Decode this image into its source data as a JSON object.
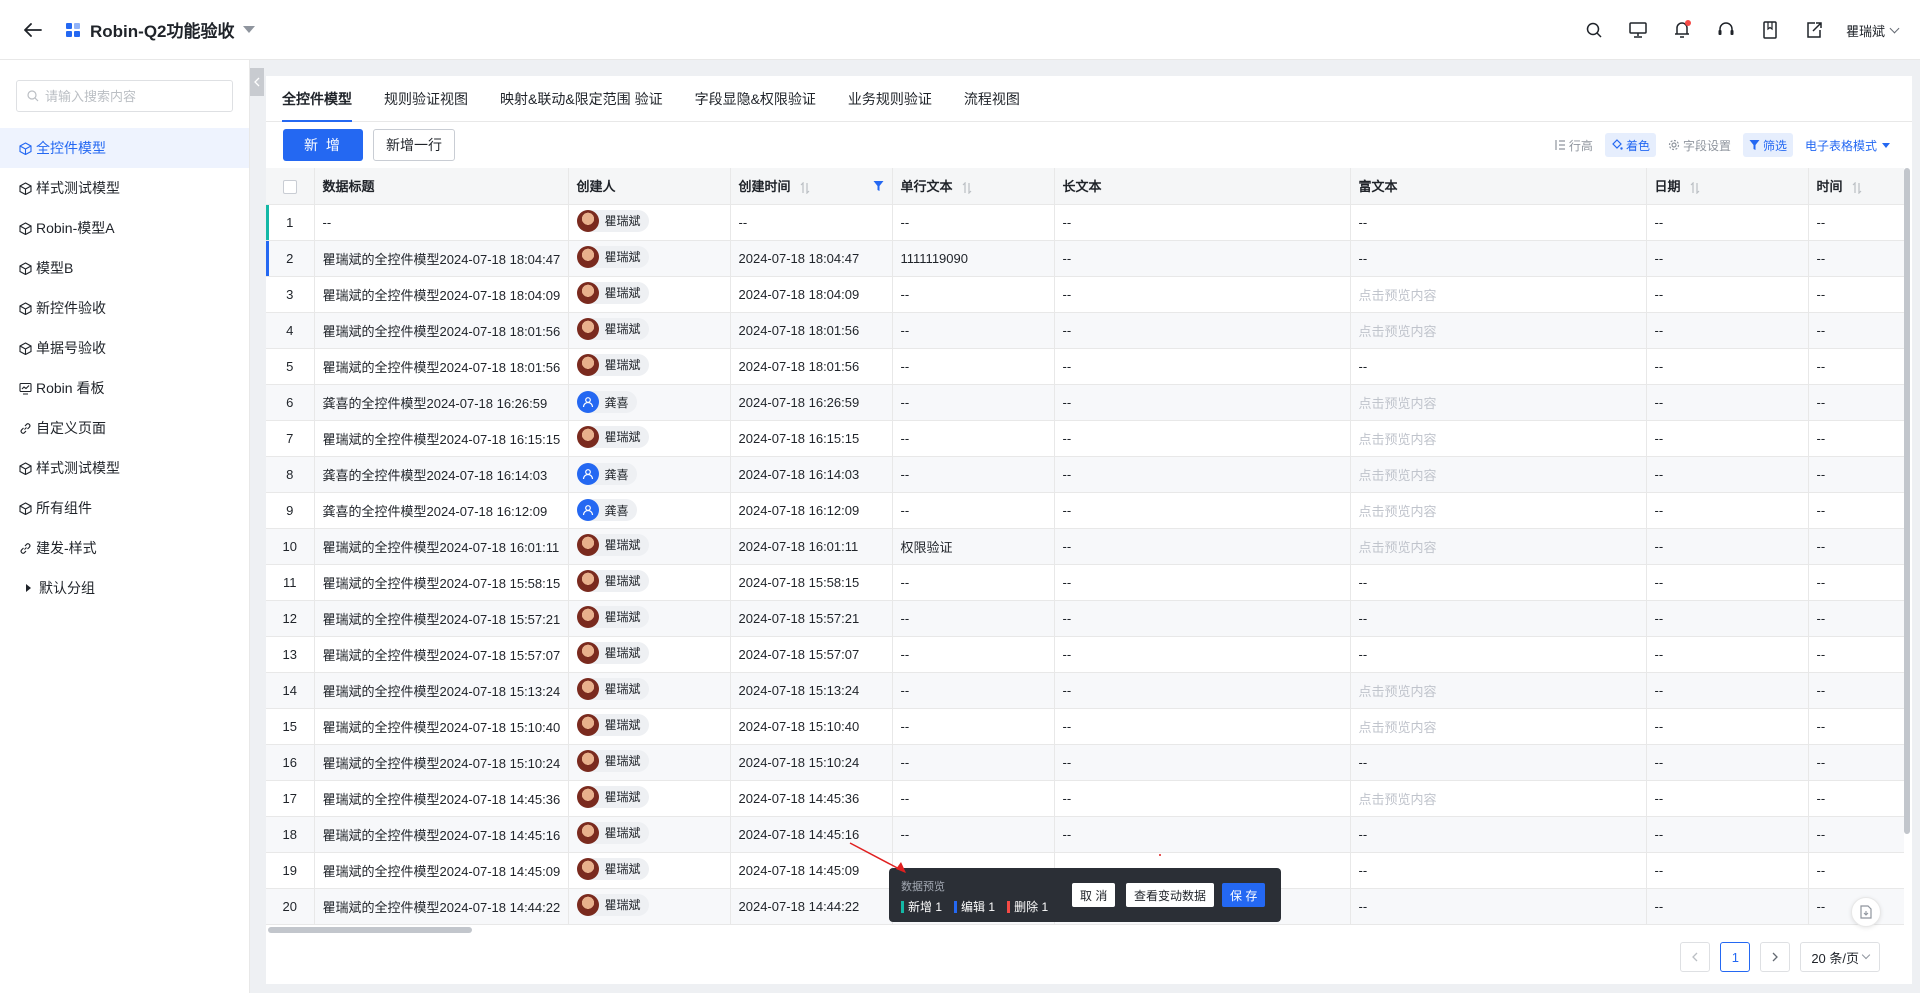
{
  "header": {
    "title": "Robin-Q2功能验收",
    "user_name": "瞿瑞斌"
  },
  "sidebar": {
    "search_placeholder": "请输入搜索内容",
    "items": [
      {
        "label": "全控件模型",
        "icon": "cube-icon",
        "active": true
      },
      {
        "label": "样式测试模型",
        "icon": "cube-icon"
      },
      {
        "label": "Robin-模型A",
        "icon": "cube-icon"
      },
      {
        "label": "模型B",
        "icon": "cube-icon"
      },
      {
        "label": "新控件验收",
        "icon": "cube-icon"
      },
      {
        "label": "单据号验收",
        "icon": "cube-icon"
      },
      {
        "label": "Robin 看板",
        "icon": "dashboard-icon"
      },
      {
        "label": "自定义页面",
        "icon": "link-icon"
      },
      {
        "label": "样式测试模型",
        "icon": "cube-icon"
      },
      {
        "label": "所有组件",
        "icon": "cube-icon"
      },
      {
        "label": "建发-样式",
        "icon": "link-icon"
      },
      {
        "label": "默认分组",
        "icon": "caret-right-icon"
      }
    ]
  },
  "tabs": [
    "全控件模型",
    "规则验证视图",
    "映射&联动&限定范围 验证",
    "字段显隐&权限验证",
    "业务规则验证",
    "流程视图"
  ],
  "toolbar": {
    "add_label": "新 增",
    "add_row_label": "新增一行",
    "row_height_label": "行高",
    "color_label": "着色",
    "field_settings_label": "字段设置",
    "filter_label": "筛选",
    "mode_label": "电子表格模式"
  },
  "table": {
    "columns": [
      "数据标题",
      "创建人",
      "创建时间",
      "单行文本",
      "长文本",
      "富文本",
      "日期",
      "时间"
    ],
    "rows": [
      {
        "no": "1",
        "title": "--",
        "creator": "瞿瑞斌",
        "avatar": "photo",
        "time": "--",
        "single": "--",
        "long": "--",
        "rich": "--",
        "date": "--",
        "clock": "--"
      },
      {
        "no": "2",
        "title": "瞿瑞斌的全控件模型2024-07-18 18:04:47",
        "creator": "瞿瑞斌",
        "avatar": "photo",
        "time": "2024-07-18 18:04:47",
        "single": "1111119090",
        "long": "--",
        "rich": "--",
        "date": "--",
        "clock": "--"
      },
      {
        "no": "3",
        "title": "瞿瑞斌的全控件模型2024-07-18 18:04:09",
        "creator": "瞿瑞斌",
        "avatar": "photo",
        "time": "2024-07-18 18:04:09",
        "single": "--",
        "long": "--",
        "rich": "点击预览内容",
        "date": "--",
        "clock": "--"
      },
      {
        "no": "4",
        "title": "瞿瑞斌的全控件模型2024-07-18 18:01:56",
        "creator": "瞿瑞斌",
        "avatar": "photo",
        "time": "2024-07-18 18:01:56",
        "single": "--",
        "long": "--",
        "rich": "点击预览内容",
        "date": "--",
        "clock": "--"
      },
      {
        "no": "5",
        "title": "瞿瑞斌的全控件模型2024-07-18 18:01:56",
        "creator": "瞿瑞斌",
        "avatar": "photo",
        "time": "2024-07-18 18:01:56",
        "single": "--",
        "long": "--",
        "rich": "--",
        "date": "--",
        "clock": "--"
      },
      {
        "no": "6",
        "title": "龚喜的全控件模型2024-07-18 16:26:59",
        "creator": "龚喜",
        "avatar": "blue",
        "time": "2024-07-18 16:26:59",
        "single": "--",
        "long": "--",
        "rich": "点击预览内容",
        "date": "--",
        "clock": "--"
      },
      {
        "no": "7",
        "title": "瞿瑞斌的全控件模型2024-07-18 16:15:15",
        "creator": "瞿瑞斌",
        "avatar": "photo",
        "time": "2024-07-18 16:15:15",
        "single": "--",
        "long": "--",
        "rich": "点击预览内容",
        "date": "--",
        "clock": "--"
      },
      {
        "no": "8",
        "title": "龚喜的全控件模型2024-07-18 16:14:03",
        "creator": "龚喜",
        "avatar": "blue",
        "time": "2024-07-18 16:14:03",
        "single": "--",
        "long": "--",
        "rich": "点击预览内容",
        "date": "--",
        "clock": "--"
      },
      {
        "no": "9",
        "title": "龚喜的全控件模型2024-07-18 16:12:09",
        "creator": "龚喜",
        "avatar": "blue",
        "time": "2024-07-18 16:12:09",
        "single": "--",
        "long": "--",
        "rich": "点击预览内容",
        "date": "--",
        "clock": "--"
      },
      {
        "no": "10",
        "title": "瞿瑞斌的全控件模型2024-07-18 16:01:11",
        "creator": "瞿瑞斌",
        "avatar": "photo",
        "time": "2024-07-18 16:01:11",
        "single": "权限验证",
        "long": "--",
        "rich": "点击预览内容",
        "date": "--",
        "clock": "--"
      },
      {
        "no": "11",
        "title": "瞿瑞斌的全控件模型2024-07-18 15:58:15",
        "creator": "瞿瑞斌",
        "avatar": "photo",
        "time": "2024-07-18 15:58:15",
        "single": "--",
        "long": "--",
        "rich": "--",
        "date": "--",
        "clock": "--"
      },
      {
        "no": "12",
        "title": "瞿瑞斌的全控件模型2024-07-18 15:57:21",
        "creator": "瞿瑞斌",
        "avatar": "photo",
        "time": "2024-07-18 15:57:21",
        "single": "--",
        "long": "--",
        "rich": "--",
        "date": "--",
        "clock": "--"
      },
      {
        "no": "13",
        "title": "瞿瑞斌的全控件模型2024-07-18 15:57:07",
        "creator": "瞿瑞斌",
        "avatar": "photo",
        "time": "2024-07-18 15:57:07",
        "single": "--",
        "long": "--",
        "rich": "--",
        "date": "--",
        "clock": "--"
      },
      {
        "no": "14",
        "title": "瞿瑞斌的全控件模型2024-07-18 15:13:24",
        "creator": "瞿瑞斌",
        "avatar": "photo",
        "time": "2024-07-18 15:13:24",
        "single": "--",
        "long": "--",
        "rich": "点击预览内容",
        "date": "--",
        "clock": "--"
      },
      {
        "no": "15",
        "title": "瞿瑞斌的全控件模型2024-07-18 15:10:40",
        "creator": "瞿瑞斌",
        "avatar": "photo",
        "time": "2024-07-18 15:10:40",
        "single": "--",
        "long": "--",
        "rich": "点击预览内容",
        "date": "--",
        "clock": "--"
      },
      {
        "no": "16",
        "title": "瞿瑞斌的全控件模型2024-07-18 15:10:24",
        "creator": "瞿瑞斌",
        "avatar": "photo",
        "time": "2024-07-18 15:10:24",
        "single": "--",
        "long": "--",
        "rich": "--",
        "date": "--",
        "clock": "--"
      },
      {
        "no": "17",
        "title": "瞿瑞斌的全控件模型2024-07-18 14:45:36",
        "creator": "瞿瑞斌",
        "avatar": "photo",
        "time": "2024-07-18 14:45:36",
        "single": "--",
        "long": "--",
        "rich": "点击预览内容",
        "date": "--",
        "clock": "--"
      },
      {
        "no": "18",
        "title": "瞿瑞斌的全控件模型2024-07-18 14:45:16",
        "creator": "瞿瑞斌",
        "avatar": "photo",
        "time": "2024-07-18 14:45:16",
        "single": "--",
        "long": "--",
        "rich": "--",
        "date": "--",
        "clock": "--"
      },
      {
        "no": "19",
        "title": "瞿瑞斌的全控件模型2024-07-18 14:45:09",
        "creator": "瞿瑞斌",
        "avatar": "photo",
        "time": "2024-07-18 14:45:09",
        "single": "",
        "long": "",
        "rich": "--",
        "date": "--",
        "clock": "--"
      },
      {
        "no": "20",
        "title": "瞿瑞斌的全控件模型2024-07-18 14:44:22",
        "creator": "瞿瑞斌",
        "avatar": "photo",
        "time": "2024-07-18 14:44:22",
        "single": "",
        "long": "",
        "rich": "--",
        "date": "--",
        "clock": "--"
      }
    ]
  },
  "preview": {
    "title": "数据预览",
    "new_label": "新增",
    "new_count": "1",
    "edit_label": "编辑",
    "edit_count": "1",
    "delete_label": "删除",
    "delete_count": "1",
    "cancel_label": "取 消",
    "view_label": "查看变动数据",
    "save_label": "保 存"
  },
  "pagination": {
    "current_page": "1",
    "page_size": "20 条/页"
  },
  "colors": {
    "primary": "#2468f2",
    "new_indicator": "#14b8a6",
    "edit_indicator": "#2468f2",
    "delete_indicator": "#f54a45"
  }
}
